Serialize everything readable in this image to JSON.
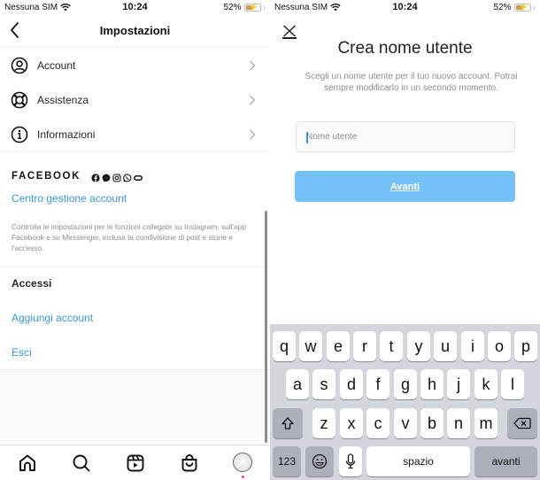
{
  "status_bar": {
    "carrier": "Nessuna SIM",
    "time": "10:24",
    "battery": "52%",
    "battery_level": 0.52
  },
  "settings_screen": {
    "title": "Impostazioni",
    "back_icon": "chevron-left-icon",
    "menu_items": [
      {
        "label": "Account",
        "icon": "user-circle-icon"
      },
      {
        "label": "Assistenza",
        "icon": "lifebuoy-icon"
      },
      {
        "label": "Informazioni",
        "icon": "info-icon"
      }
    ],
    "facebook": {
      "logo": "FACEBOOK",
      "app_icons": [
        "facebook-icon",
        "messenger-icon",
        "instagram-icon",
        "whatsapp-icon",
        "oculus-icon"
      ],
      "accounts_center_link": "Centro gestione account",
      "description": "Controlla le impostazioni per le funzioni collegate su Instagram, sull'app Facebook e su Messenger, inclusa la condivisione di post e storie e l'accesso."
    },
    "logins": {
      "title": "Accessi",
      "add_account": "Aggiungi account",
      "logout": "Esci"
    },
    "tab_bar": [
      {
        "name": "home",
        "icon": "home-icon"
      },
      {
        "name": "search",
        "icon": "search-icon"
      },
      {
        "name": "reels",
        "icon": "reels-icon"
      },
      {
        "name": "shop",
        "icon": "shopping-bag-icon"
      },
      {
        "name": "profile",
        "icon": "avatar"
      }
    ]
  },
  "username_screen": {
    "close_icon": "close-icon",
    "title": "Crea nome utente",
    "description": "Scegli un nome utente per il tuo nuovo account. Potrai sempre modificarlo in un secondo momento.",
    "input": {
      "placeholder": "Nome utente",
      "value": ""
    },
    "next_button": "Avanti",
    "colors": {
      "button": "#74c1f7",
      "link": "#3b95d6"
    }
  },
  "keyboard": {
    "row1": [
      "q",
      "w",
      "e",
      "r",
      "t",
      "y",
      "u",
      "i",
      "o",
      "p"
    ],
    "row2": [
      "a",
      "s",
      "d",
      "f",
      "g",
      "h",
      "j",
      "k",
      "l"
    ],
    "row3": [
      "z",
      "x",
      "c",
      "v",
      "b",
      "n",
      "m"
    ],
    "numbers_key": "123",
    "space_key": "spazio",
    "return_key": "avanti"
  }
}
